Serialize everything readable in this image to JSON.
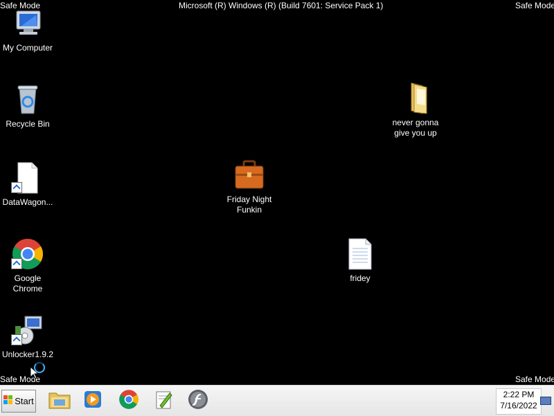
{
  "overlay": {
    "top_left": "Safe Mode",
    "top_center": "Microsoft (R) Windows (R) (Build 7601: Service Pack 1)",
    "top_right": "Safe Mode",
    "bottom_left": "Safe Mode",
    "bottom_right": "Safe Mode"
  },
  "desktop": {
    "icons": [
      {
        "label_lines": [
          "My Computer"
        ],
        "icon": "computer-icon"
      },
      {
        "label_lines": [
          "Recycle Bin"
        ],
        "icon": "recycle-bin-icon"
      },
      {
        "label_lines": [
          "DataWagon..."
        ],
        "icon": "document-shortcut-icon"
      },
      {
        "label_lines": [
          "Google",
          "Chrome"
        ],
        "icon": "chrome-icon"
      },
      {
        "label_lines": [
          "Unlocker1.9.2"
        ],
        "icon": "unlocker-icon"
      },
      {
        "label_lines": [
          "Friday Night",
          "Funkin"
        ],
        "icon": "briefcase-icon"
      },
      {
        "label_lines": [
          "never gonna",
          "give you up"
        ],
        "icon": "folder-icon"
      },
      {
        "label_lines": [
          "fridey"
        ],
        "icon": "text-file-icon"
      }
    ]
  },
  "taskbar": {
    "start_label": "Start",
    "pinned": [
      {
        "icon": "explorer-icon"
      },
      {
        "icon": "media-player-icon"
      },
      {
        "icon": "chrome-icon"
      },
      {
        "icon": "notepad-plus-icon"
      },
      {
        "icon": "flash-icon"
      }
    ],
    "clock": {
      "time": "2:22 PM",
      "date": "7/16/2022"
    }
  }
}
